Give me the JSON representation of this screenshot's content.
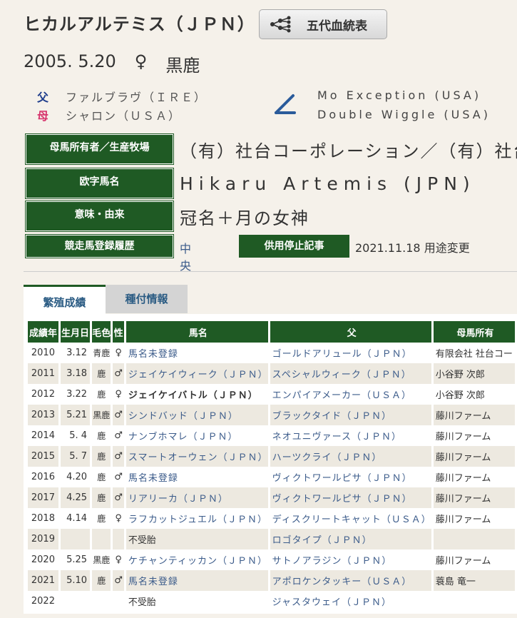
{
  "horse": {
    "name": "ヒカルアルテミス（ＪＰＮ）",
    "pedigree_button": "五代血統表",
    "birth_date": "2005. 5.20",
    "sex_symbol": "♀",
    "coat": "黒鹿"
  },
  "parents": {
    "sire_tag": "父",
    "sire_name": "ファルブラヴ（ＩＲＥ）",
    "dam_tag": "母",
    "dam_name": "シャロン（ＵＳＡ）",
    "bms_1": "Mo Exception (USA)",
    "bms_2": "Double Wiggle (USA)"
  },
  "info": {
    "owner_label": "母馬所有者／生産牧場",
    "owner_value": "（有）社台コーポレーション／（有）社台",
    "roman_label": "欧字馬名",
    "roman_value": "Hikaru Artemis (JPN)",
    "meaning_label": "意味・由来",
    "meaning_value": "冠名＋月の女神",
    "registry_label": "競走馬登録履歴",
    "registry_value": "中央",
    "stop_label": "供用停止記事",
    "stop_value": "2021.11.18 用途変更"
  },
  "tabs": [
    "繁殖成績",
    "種付情報"
  ],
  "table": {
    "headers": [
      "成績年",
      "生月日",
      "毛色",
      "性",
      "馬名",
      "父",
      "母馬所有"
    ],
    "rows": [
      [
        "2010",
        "3.12",
        "青鹿",
        "♀",
        "馬名未登録",
        "ゴールドアリュール（ＪＰＮ）",
        "有限会社 社台コー"
      ],
      [
        "2011",
        "3.18",
        "鹿",
        "♂",
        "ジェイケイウィーク（ＪＰＮ）",
        "スペシャルウィーク（ＪＰＮ）",
        "小谷野 次郎"
      ],
      [
        "2012",
        "3.22",
        "鹿",
        "♀",
        "ジェイケイバトル（ＪＰＮ）",
        "エンパイアメーカー（ＵＳＡ）",
        "小谷野 次郎"
      ],
      [
        "2013",
        "5.21",
        "黒鹿",
        "♂",
        "シンドバッド（ＪＰＮ）",
        "ブラックタイド（ＪＰＮ）",
        "藤川ファーム"
      ],
      [
        "2014",
        "5. 4",
        "鹿",
        "♂",
        "ナンブホマレ（ＪＰＮ）",
        "ネオユニヴァース（ＪＰＮ）",
        "藤川ファーム"
      ],
      [
        "2015",
        "5. 7",
        "鹿",
        "♂",
        "スマートオーウェン（ＪＰＮ）",
        "ハーツクライ（ＪＰＮ）",
        "藤川ファーム"
      ],
      [
        "2016",
        "4.20",
        "鹿",
        "♂",
        "馬名未登録",
        "ヴィクトワールピサ（ＪＰＮ）",
        "藤川ファーム"
      ],
      [
        "2017",
        "4.25",
        "鹿",
        "♂",
        "リアリーカ（ＪＰＮ）",
        "ヴィクトワールピサ（ＪＰＮ）",
        "藤川ファーム"
      ],
      [
        "2018",
        "4.14",
        "鹿",
        "♀",
        "ラフカットジュエル（ＪＰＮ）",
        "ディスクリートキャット（ＵＳＡ）",
        "藤川ファーム"
      ],
      [
        "2019",
        "",
        "",
        "",
        "不受胎",
        "ロゴタイプ（ＪＰＮ）",
        ""
      ],
      [
        "2020",
        "5.25",
        "黒鹿",
        "♀",
        "ケチャンティッカン（ＪＰＮ）",
        "サトノアラジン（ＪＰＮ）",
        "藤川ファーム"
      ],
      [
        "2021",
        "5.10",
        "鹿",
        "♂",
        "馬名未登録",
        "アポロケンタッキー（ＵＳＡ）",
        "蓑島 竜一"
      ],
      [
        "2022",
        "",
        "",
        "",
        "不受胎",
        "ジャスタウェイ（ＪＰＮ）",
        ""
      ]
    ]
  },
  "colors": {
    "green": "#1f5a24",
    "link": "#3b5b8a",
    "sire_tag": "#1f3e8c",
    "dam_tag": "#d6336c"
  },
  "icons": {
    "pedigree_button_icon": "pedigree-tree-icon",
    "bms_icon": "slash-angle-icon"
  }
}
